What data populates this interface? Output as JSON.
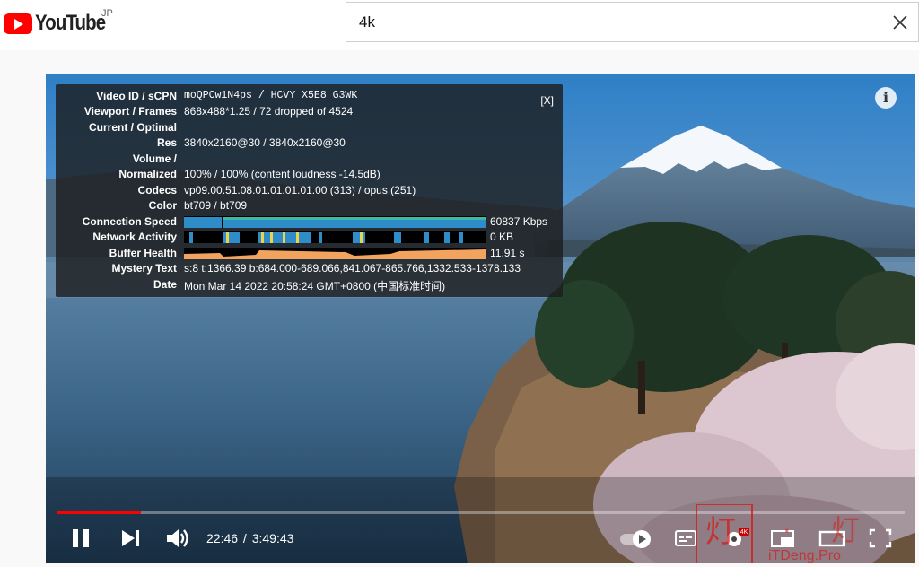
{
  "header": {
    "logo_text": "YouTube",
    "region": "JP",
    "search_value": "4k"
  },
  "stats": {
    "close_label": "[X]",
    "rows": [
      {
        "label": "Video ID / sCPN",
        "value": "moQPCw1N4ps / HCVY X5E8 G3WK"
      },
      {
        "label": "Viewport / Frames",
        "value": "868x488*1.25 / 72 dropped of 4524"
      },
      {
        "label": "Current / Optimal",
        "value": ""
      },
      {
        "label": "Res",
        "value": "3840x2160@30 / 3840x2160@30"
      },
      {
        "label": "Volume /",
        "value": ""
      },
      {
        "label": "Normalized",
        "value": "100% / 100% (content loudness -14.5dB)"
      },
      {
        "label": "Codecs",
        "value": "vp09.00.51.08.01.01.01.01.00 (313) / opus (251)"
      },
      {
        "label": "Color",
        "value": "bt709 / bt709"
      },
      {
        "label": "Connection Speed",
        "value": "60837 Kbps"
      },
      {
        "label": "Network Activity",
        "value": "0 KB"
      },
      {
        "label": "Buffer Health",
        "value": "11.91 s"
      },
      {
        "label": "Mystery Text",
        "value": "s:8 t:1366.39 b:684.000-689.066,841.067-865.766,1332.533-1378.133"
      },
      {
        "label": "Date",
        "value": "Mon Mar 14 2022 20:58:24 GMT+0800 (中国标准时间)"
      }
    ]
  },
  "player": {
    "current_time": "22:46",
    "duration": "3:49:43",
    "progress_fraction": 0.099,
    "quality_badge": "4K",
    "progress_color": "#ff0000"
  },
  "watermark": {
    "text": "灯 · 灯",
    "domain": "iTDeng.Pro"
  }
}
